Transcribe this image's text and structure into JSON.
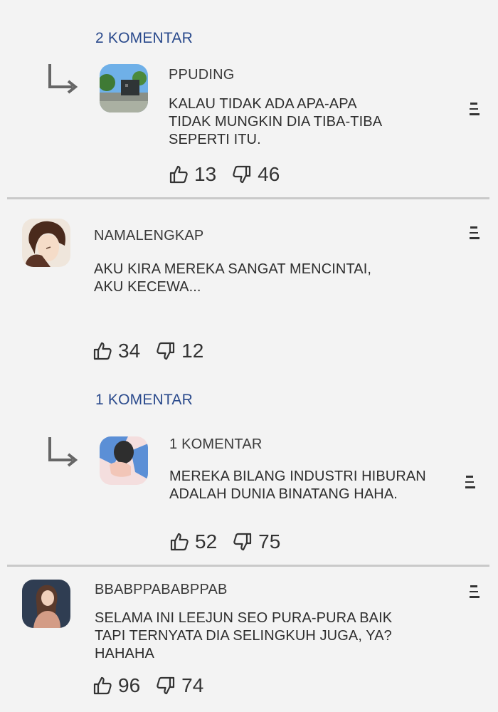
{
  "thread1": {
    "replies_link": "2 KOMENTAR",
    "reply": {
      "username": "PPUDING",
      "text": "KALAU TIDAK ADA APA-APA\nTIDAK MUNGKIN DIA TIBA-TIBA\nSEPERTI ITU.",
      "likes": "13",
      "dislikes": "46"
    }
  },
  "comment2": {
    "username": "NAMALENGKAP",
    "text": "AKU KIRA MEREKA SANGAT MENCINTAI,\nAKU KECEWA...",
    "likes": "34",
    "dislikes": "12",
    "replies_link": "1 KOMENTAR",
    "reply": {
      "username": "1 KOMENTAR",
      "text": "MEREKA BILANG INDUSTRI HIBURAN\nADALAH DUNIA BINATANG HAHA.",
      "likes": "52",
      "dislikes": "75"
    }
  },
  "comment3": {
    "username": "BBABPPABABPPAB",
    "text": "SELAMA INI LEEJUN SEO PURA-PURA BAIK\nTAPI TERNYATA DIA SELINGKUH JUGA, YA?\nHAHAHA",
    "likes": "96",
    "dislikes": "74"
  },
  "icons": {
    "like": "thumbs-up-icon",
    "dislike": "thumbs-down-icon",
    "menu": "menu-icon",
    "reply_arrow": "reply-arrow-icon"
  },
  "colors": {
    "background": "#f3f3f3",
    "replies_link": "#2a4a8c",
    "divider": "#c9c9c9"
  }
}
